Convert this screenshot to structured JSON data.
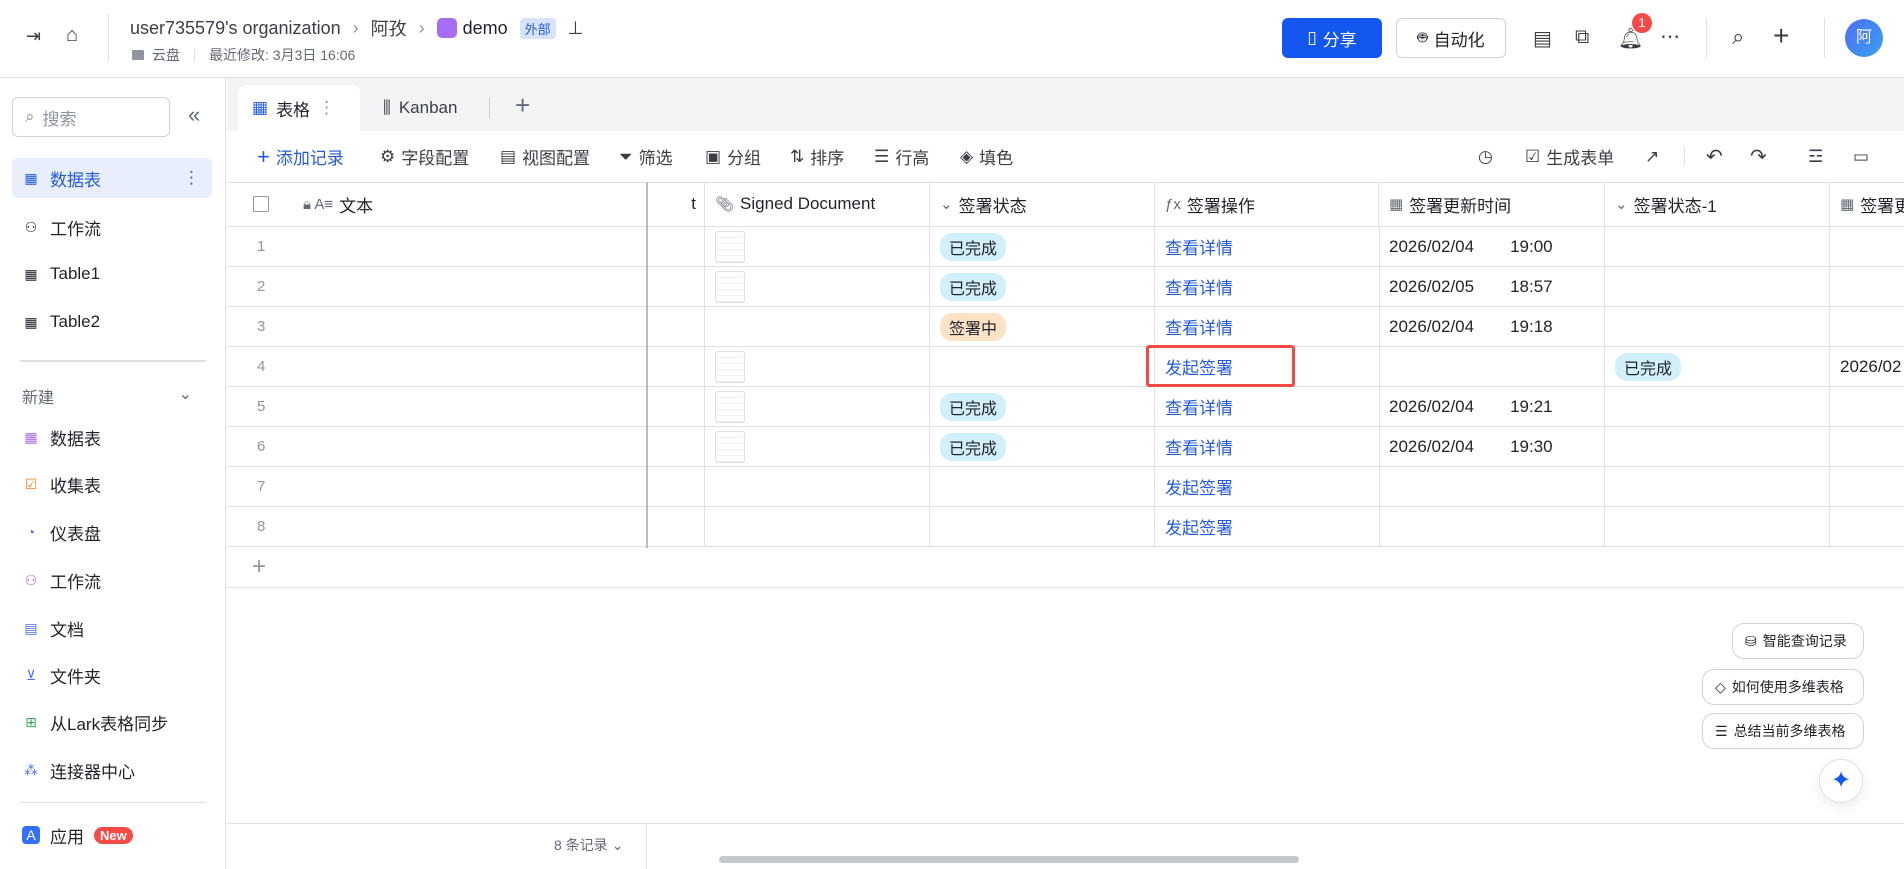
{
  "header": {
    "breadcrumb": [
      "user735579's organization",
      "阿孜",
      "demo"
    ],
    "external_badge": "外部",
    "location": "云盘",
    "last_modified": "最近修改: 3月3日 16:06",
    "share_label": "分享",
    "automation_label": "自动化",
    "notification_count": "1",
    "avatar": "阿"
  },
  "sidebar": {
    "search_placeholder": "搜索",
    "items": [
      {
        "label": "数据表"
      },
      {
        "label": "工作流"
      },
      {
        "label": "Table1"
      },
      {
        "label": "Table2"
      }
    ],
    "new_section": "新建",
    "new_items": [
      {
        "label": "数据表"
      },
      {
        "label": "收集表"
      },
      {
        "label": "仪表盘"
      },
      {
        "label": "工作流"
      },
      {
        "label": "文档"
      },
      {
        "label": "文件夹"
      },
      {
        "label": "从Lark表格同步"
      },
      {
        "label": "连接器中心"
      }
    ],
    "apps_label": "应用",
    "apps_badge": "New"
  },
  "tabs": [
    {
      "label": "表格"
    },
    {
      "label": "Kanban"
    }
  ],
  "toolbar": {
    "add_record": "添加记录",
    "field_config": "字段配置",
    "view_config": "视图配置",
    "filter": "筛选",
    "group": "分组",
    "sort": "排序",
    "row_height": "行高",
    "fill_color": "填色",
    "generate_form": "生成表单"
  },
  "table": {
    "columns": [
      "文本",
      "t",
      "Signed Document",
      "签署状态",
      "签署操作",
      "签署更新时间",
      "签署状态-1",
      "签署更"
    ],
    "rows": [
      {
        "num": "1",
        "doc": true,
        "status": "已完成",
        "action": "查看详情",
        "date": "2026/02/04",
        "time": "19:00",
        "status1": "",
        "date2": ""
      },
      {
        "num": "2",
        "doc": true,
        "status": "已完成",
        "action": "查看详情",
        "date": "2026/02/05",
        "time": "18:57",
        "status1": "",
        "date2": ""
      },
      {
        "num": "3",
        "doc": false,
        "status": "签署中",
        "action": "查看详情",
        "date": "2026/02/04",
        "time": "19:18",
        "status1": "",
        "date2": ""
      },
      {
        "num": "4",
        "doc": true,
        "status": "",
        "action": "发起签署",
        "date": "",
        "time": "",
        "status1": "已完成",
        "date2": "2026/02"
      },
      {
        "num": "5",
        "doc": true,
        "status": "已完成",
        "action": "查看详情",
        "date": "2026/02/04",
        "time": "19:21",
        "status1": "",
        "date2": ""
      },
      {
        "num": "6",
        "doc": true,
        "status": "已完成",
        "action": "查看详情",
        "date": "2026/02/04",
        "time": "19:30",
        "status1": "",
        "date2": ""
      },
      {
        "num": "7",
        "doc": false,
        "status": "",
        "action": "发起签署",
        "date": "",
        "time": "",
        "status1": "",
        "date2": ""
      },
      {
        "num": "8",
        "doc": false,
        "status": "",
        "action": "发起签署",
        "date": "",
        "time": "",
        "status1": "",
        "date2": ""
      }
    ],
    "record_count": "8 条记录"
  },
  "assistant": {
    "suggestions": [
      "智能查询记录",
      "如何使用多维表格",
      "总结当前多维表格"
    ]
  },
  "colors": {
    "accent": "#1456f0",
    "done_bg": "#d1f0fc",
    "signing_bg": "#fde2c6",
    "highlight": "#f54a45"
  }
}
